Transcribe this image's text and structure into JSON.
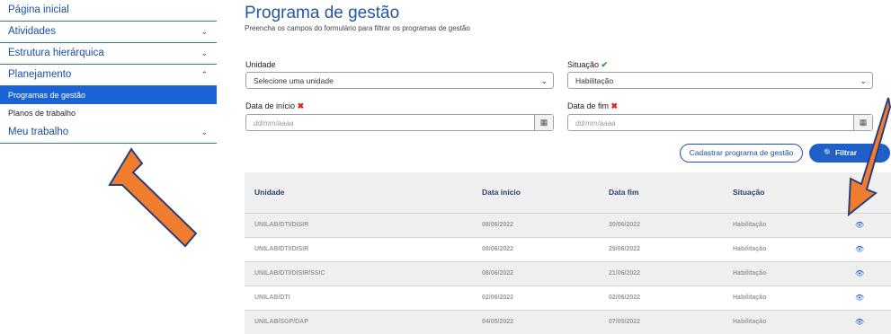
{
  "sidebar": {
    "home": "Página inicial",
    "activities": "Atividades",
    "hierarchy": "Estrutura hierárquica",
    "planning": "Planejamento",
    "sub_programs": "Programas de gestão",
    "sub_plans": "Planos de trabalho",
    "my_work": "Meu trabalho"
  },
  "page": {
    "title": "Programa de gestão",
    "subtitle": "Preencha os campos do formulário para filtrar os programas de gestão"
  },
  "form": {
    "unit_label": "Unidade",
    "unit_value": "Selecione uma unidade",
    "situation_label": "Situação",
    "situation_value": "Habilitação",
    "start_label": "Data de início",
    "start_placeholder": "dd/mm/aaaa",
    "end_label": "Data de fim",
    "end_placeholder": "dd/mm/aaaa",
    "check_mark": "✔",
    "x_mark": "✖"
  },
  "buttons": {
    "register": "Cadastrar programa de gestão",
    "filter": "Filtrar"
  },
  "table": {
    "headers": [
      "Unidade",
      "Data início",
      "Data fim",
      "Situação"
    ],
    "rows": [
      [
        "UNILAB/DTI/DISIR",
        "08/06/2022",
        "30/06/2022",
        "Habilitação"
      ],
      [
        "UNILAB/DTI/DISIR",
        "08/06/2022",
        "29/06/2022",
        "Habilitação"
      ],
      [
        "UNILAB/DTI/DISIR/SSIC",
        "08/06/2022",
        "21/06/2022",
        "Habilitação"
      ],
      [
        "UNILAB/DTI",
        "02/06/2022",
        "02/06/2022",
        "Habilitação"
      ],
      [
        "UNILAB/SGP/DAP",
        "04/05/2022",
        "07/05/2022",
        "Habilitação"
      ]
    ]
  },
  "colors": {
    "accent": "#1f5fc8",
    "annotation_arrow": "#f07d2e"
  }
}
